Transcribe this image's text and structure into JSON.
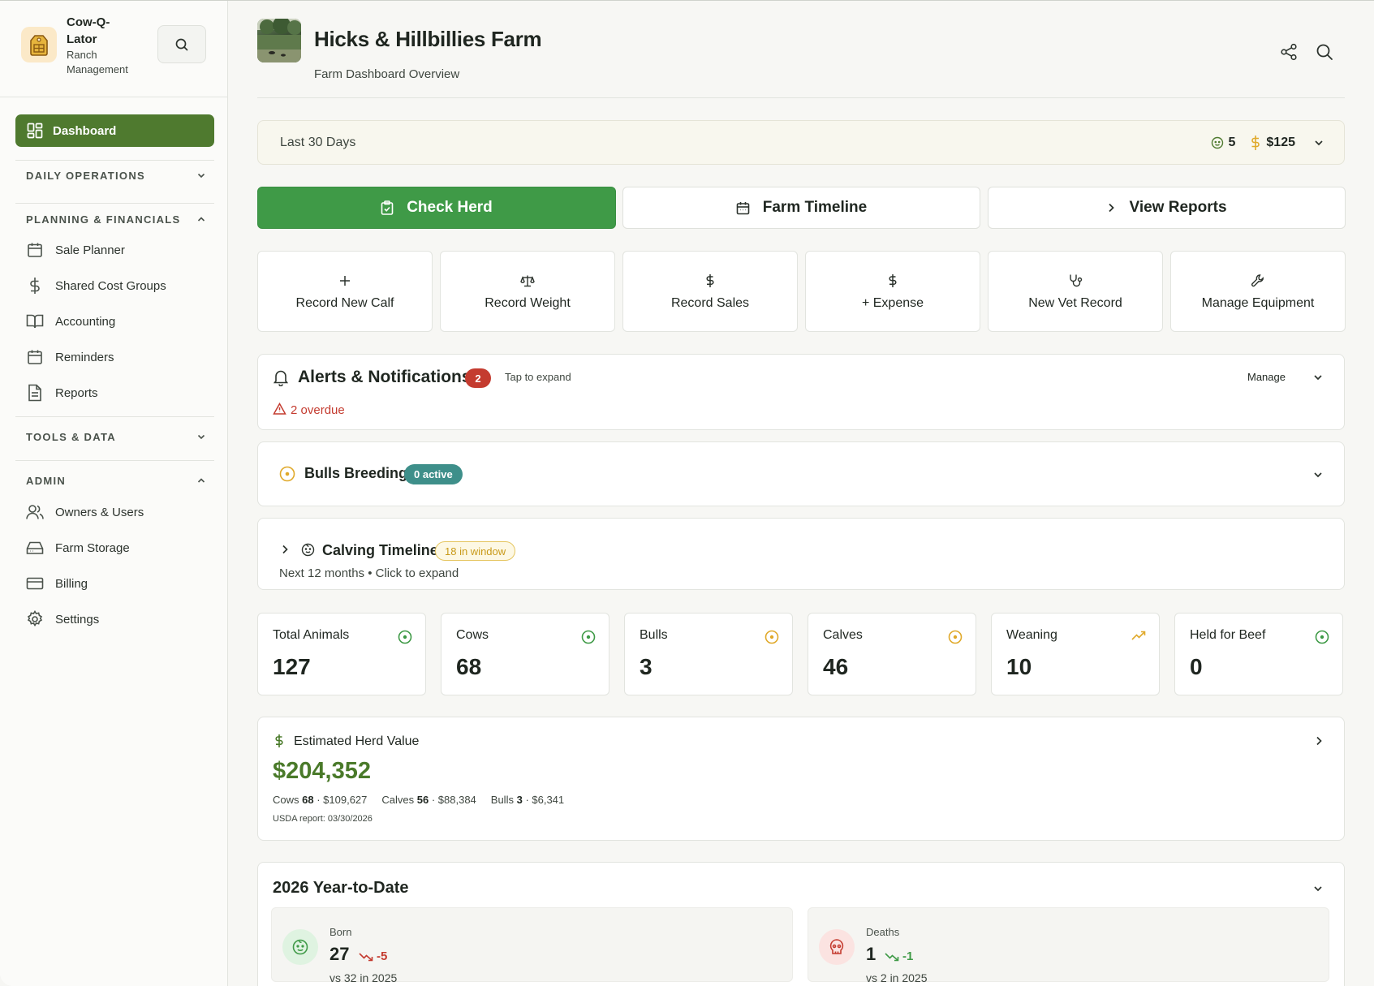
{
  "brand": {
    "name_line1": "Cow-Q-",
    "name_line2": "Lator",
    "sub_line1": "Ranch",
    "sub_line2": "Management"
  },
  "sidebar": {
    "active": "Dashboard",
    "sections": {
      "daily": "DAILY OPERATIONS",
      "planning": "PLANNING & FINANCIALS",
      "tools": "TOOLS & DATA",
      "admin": "ADMIN"
    },
    "planning_items": [
      "Sale Planner",
      "Shared Cost Groups",
      "Accounting",
      "Reminders",
      "Reports"
    ],
    "admin_items": [
      "Owners & Users",
      "Farm Storage",
      "Billing",
      "Settings"
    ]
  },
  "header": {
    "title": "Hicks & Hillbillies Farm",
    "subtitle": "Farm Dashboard Overview"
  },
  "period": {
    "label": "Last 30 Days",
    "count": "5",
    "amount": "$125"
  },
  "actions": {
    "check_herd": "Check Herd",
    "timeline": "Farm Timeline",
    "reports": "View Reports"
  },
  "quick_actions": [
    "Record New Calf",
    "Record Weight",
    "Record Sales",
    "+ Expense",
    "New Vet Record",
    "Manage Equipment"
  ],
  "alerts": {
    "title": "Alerts & Notifications",
    "count": "2",
    "hint": "Tap to expand",
    "manage": "Manage",
    "overdue": "2 overdue"
  },
  "bulls": {
    "title": "Bulls Breeding",
    "badge": "0 active"
  },
  "calving": {
    "title": "Calving Timeline",
    "badge": "18 in window",
    "sub": "Next 12 months • Click to expand"
  },
  "stats": [
    {
      "label": "Total Animals",
      "value": "127"
    },
    {
      "label": "Cows",
      "value": "68"
    },
    {
      "label": "Bulls",
      "value": "3"
    },
    {
      "label": "Calves",
      "value": "46"
    },
    {
      "label": "Weaning",
      "value": "10"
    },
    {
      "label": "Held for Beef",
      "value": "0"
    }
  ],
  "herd_value": {
    "title": "Estimated Herd Value",
    "value": "$204,352",
    "cows_label": "Cows",
    "cows_count": "68",
    "cows_value": " · $109,627",
    "calves_label": "Calves",
    "calves_count": "56",
    "calves_value": " · $88,384",
    "bulls_label": "Bulls",
    "bulls_count": "3",
    "bulls_value": " · $6,341",
    "report": "USDA report: 03/30/2026"
  },
  "ytd": {
    "title": "2026 Year-to-Date",
    "born_label": "Born",
    "born_value": "27",
    "born_delta": "-5",
    "born_compare": "vs 32 in 2025",
    "deaths_label": "Deaths",
    "deaths_value": "1",
    "deaths_delta": "-1",
    "deaths_compare": "vs 2 in 2025"
  },
  "colors": {
    "primary_green": "#3f9a47",
    "nav_active": "#4f7a2f",
    "alert_red": "#c43b2f",
    "teal": "#3e8f8a",
    "gold": "#e0a92a",
    "value_green": "#4a7a2a"
  }
}
